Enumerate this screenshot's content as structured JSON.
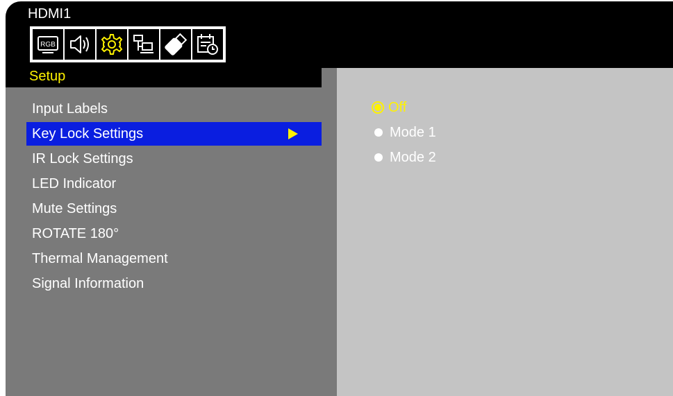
{
  "source": "HDMI1",
  "tabs": [
    {
      "icon": "rgb-picture-icon",
      "label": "RGB",
      "active": false
    },
    {
      "icon": "speaker-icon",
      "active": false
    },
    {
      "icon": "gear-icon",
      "active": true
    },
    {
      "icon": "network-icon",
      "active": false
    },
    {
      "icon": "usb-drive-icon",
      "active": false
    },
    {
      "icon": "schedule-icon",
      "active": false
    }
  ],
  "menu_title": "Setup",
  "menu": [
    {
      "label": "Input Labels"
    },
    {
      "label": "Key Lock Settings",
      "selected": true
    },
    {
      "label": "IR Lock Settings"
    },
    {
      "label": "LED Indicator"
    },
    {
      "label": "Mute Settings"
    },
    {
      "label": "ROTATE 180°"
    },
    {
      "label": "Thermal Management"
    },
    {
      "label": "Signal Information"
    }
  ],
  "options": [
    {
      "label": "Off",
      "selected": true
    },
    {
      "label": "Mode 1",
      "selected": false
    },
    {
      "label": "Mode 2",
      "selected": false
    }
  ],
  "colors": {
    "highlight": "#fff200",
    "selection_bar": "#0a1ee0",
    "left_panel": "#7a7a7a",
    "right_panel": "#c4c4c4"
  }
}
